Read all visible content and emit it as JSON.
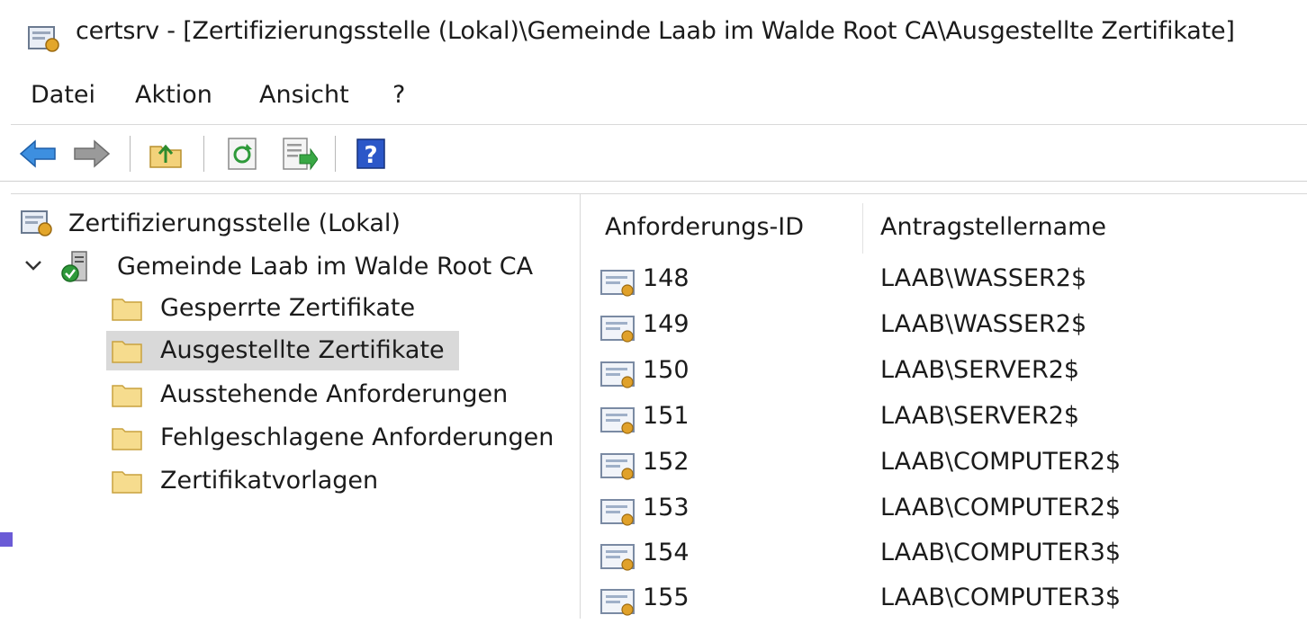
{
  "window": {
    "title": "certsrv - [Zertifizierungsstelle (Lokal)\\Gemeinde Laab im Walde Root CA\\Ausgestellte Zertifikate]",
    "icon": "certsrv-icon"
  },
  "menu": [
    "Datei",
    "Aktion",
    "Ansicht",
    "?"
  ],
  "toolbar": {
    "buttons": [
      "back-icon",
      "forward-icon",
      "up-folder-icon",
      "refresh-icon",
      "export-list-icon",
      "help-icon"
    ]
  },
  "tree": {
    "root": "Zertifizierungsstelle (Lokal)",
    "ca": "Gemeinde Laab im Walde Root CA",
    "folders": [
      "Gesperrte Zertifikate",
      "Ausgestellte Zertifikate",
      "Ausstehende Anforderungen",
      "Fehlgeschlagene Anforderungen",
      "Zertifikatvorlagen"
    ],
    "selected": "Ausgestellte Zertifikate"
  },
  "list": {
    "columns": [
      "Anforderungs-ID",
      "Antragstellername"
    ],
    "rows": [
      {
        "id": "148",
        "name": "LAAB\\WASSER2$"
      },
      {
        "id": "149",
        "name": "LAAB\\WASSER2$"
      },
      {
        "id": "150",
        "name": "LAAB\\SERVER2$"
      },
      {
        "id": "151",
        "name": "LAAB\\SERVER2$"
      },
      {
        "id": "152",
        "name": "LAAB\\COMPUTER2$"
      },
      {
        "id": "153",
        "name": "LAAB\\COMPUTER2$"
      },
      {
        "id": "154",
        "name": "LAAB\\COMPUTER3$"
      },
      {
        "id": "155",
        "name": "LAAB\\COMPUTER3$"
      }
    ]
  },
  "colors": {
    "selection": "#d9d9d9",
    "folder": "#f3d27a",
    "accent": "#2f7fd6"
  }
}
